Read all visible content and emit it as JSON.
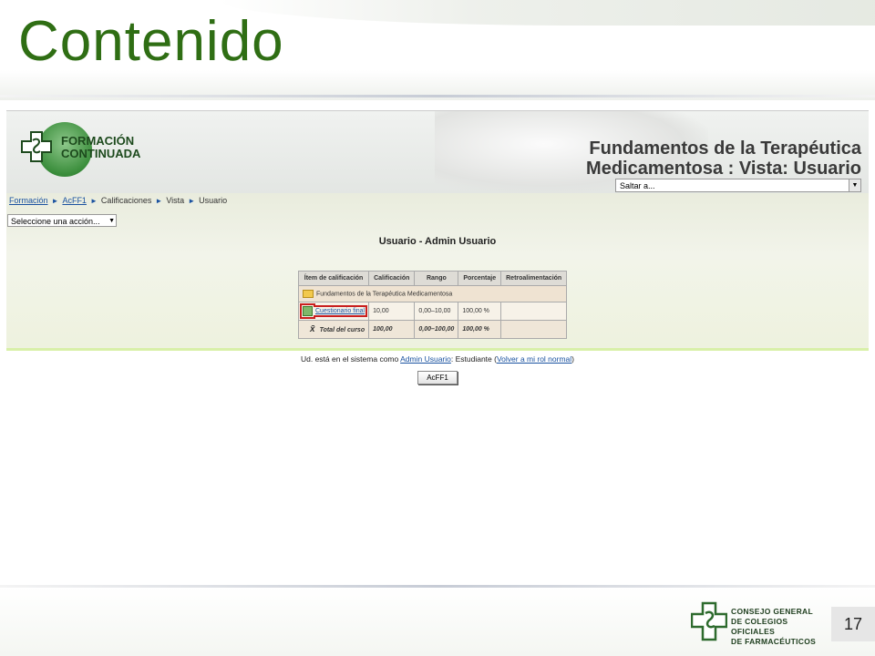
{
  "slide": {
    "title": "Contenido",
    "page_number": "17"
  },
  "banner": {
    "logo_text_line1": "FORMACIÓN",
    "logo_text_line2": "CONTINUADA",
    "course_title_line1": "Fundamentos de la Terapéutica",
    "course_title_line2": "Medicamentosa : Vista: Usuario",
    "jump_select_value": "Saltar a..."
  },
  "breadcrumb": {
    "items": [
      "Formación",
      "AcFF1",
      "Calificaciones",
      "Vista",
      "Usuario"
    ]
  },
  "action_select_value": "Seleccione una acción...",
  "page_heading": "Usuario - Admin Usuario",
  "grades_table": {
    "headers": [
      "Ítem de calificación",
      "Calificación",
      "Rango",
      "Porcentaje",
      "Retroalimentación"
    ],
    "category": "Fundamentos de la Terapéutica Medicamentosa",
    "item": {
      "name": "Cuestionario final",
      "grade": "10,00",
      "range": "0,00–10,00",
      "percent": "100,00 %",
      "feedback": ""
    },
    "total": {
      "name": "Total del curso",
      "grade": "100,00",
      "range": "0,00–100,00",
      "percent": "100,00 %"
    },
    "total_symbol": "x̄"
  },
  "footer_info": {
    "prefix": "Ud. está en el sistema como ",
    "user_link": "Admin Usuario",
    "middle": ": Estudiante (",
    "role_link": "Volver a mi rol normal",
    "suffix": ")"
  },
  "course_button_label": "AcFF1",
  "org_logo": {
    "line1": "CONSEJO GENERAL",
    "line2": "DE COLEGIOS OFICIALES",
    "line3": "DE FARMACÉUTICOS"
  },
  "colors": {
    "title_green": "#2f6e14",
    "link_blue": "#1a52a0",
    "highlight_red": "#c91f1f"
  }
}
